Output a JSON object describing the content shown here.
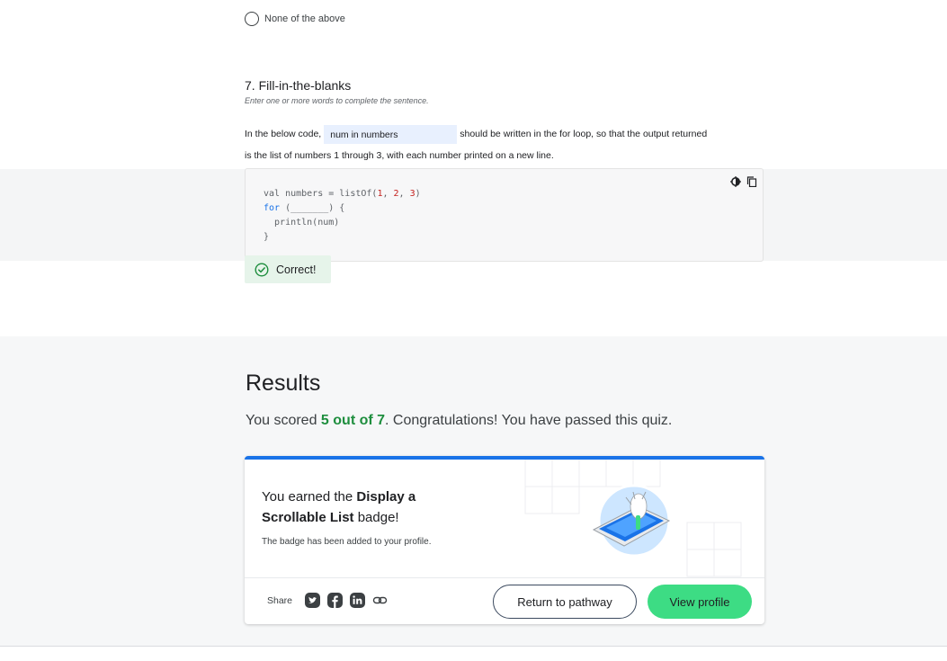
{
  "previous_question": {
    "option_label": "None of the above"
  },
  "question": {
    "title": "7. Fill-in-the-blanks",
    "subtitle": "Enter one or more words to complete the sentence.",
    "text_before": "In the below code,",
    "blank_value": "num in numbers",
    "text_after": "should be written in the for loop, so that the output returned",
    "text_line2": "is the list of numbers 1 through 3, with each number printed on a new line.",
    "code": {
      "line1_a": "val numbers = listOf(",
      "n1": "1",
      "sep1": ", ",
      "n2": "2",
      "sep2": ", ",
      "n3": "3",
      "line1_b": ")",
      "line2_kw": "for",
      "line2_rest": " (_______) {",
      "line3": "  println(num)",
      "line4": "}"
    },
    "feedback": "Correct!"
  },
  "results": {
    "title": "Results",
    "line_prefix": "You scored ",
    "score": "5 out of 7",
    "line_suffix": ". Congratulations! You have passed this quiz.",
    "badge": {
      "title_prefix": "You earned the ",
      "badge_name": "Display a Scrollable List",
      "title_suffix": " badge!",
      "description": "The badge has been added to your profile."
    },
    "share_label": "Share",
    "return_button": "Return to pathway",
    "view_profile_button": "View profile"
  },
  "colors": {
    "accent_blue": "#1a73e8",
    "success_green": "#1e8e3e",
    "android_green": "#3ddc84"
  }
}
